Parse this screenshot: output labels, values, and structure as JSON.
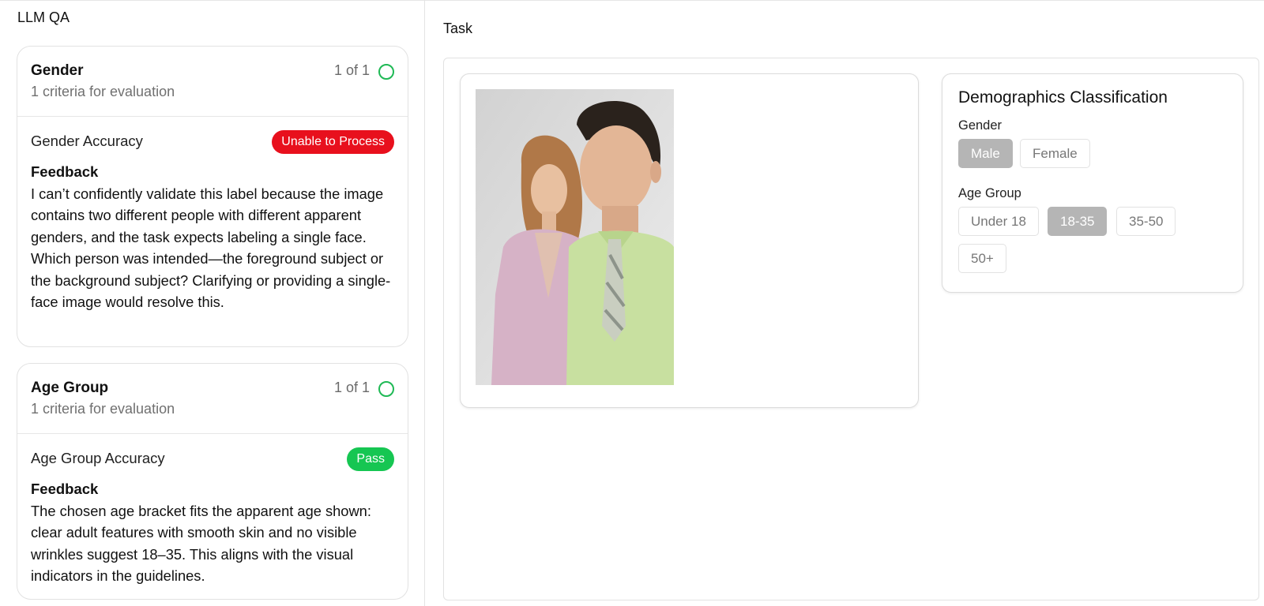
{
  "left_panel": {
    "title": "LLM QA",
    "sections": [
      {
        "title": "Gender",
        "subtitle": "1 criteria for evaluation",
        "count": "1 of 1",
        "criterion": "Gender Accuracy",
        "status": "Unable to Process",
        "status_color": "#e8101d",
        "feedback_title": "Feedback",
        "feedback": "I can’t confidently validate this label because the image contains two different people with different apparent genders, and the task expects labeling a single face. Which person was intended—the foreground subject or the background subject? Clarifying or providing a single-face image would resolve this."
      },
      {
        "title": "Age Group",
        "subtitle": "1 criteria for evaluation",
        "count": "1 of 1",
        "criterion": "Age Group Accuracy",
        "status": "Pass",
        "status_color": "#16c652",
        "feedback_title": "Feedback",
        "feedback": "The chosen age bracket fits the apparent age shown: clear adult features with smooth skin and no visible wrinkles suggest 18–35. This aligns with the visual indicators in the guidelines."
      }
    ]
  },
  "task": {
    "label": "Task",
    "image_icon": "photo-two-people",
    "classification": {
      "title": "Demographics Classification",
      "gender": {
        "label": "Gender",
        "options": [
          "Male",
          "Female"
        ],
        "selected": "Male"
      },
      "age_group": {
        "label": "Age Group",
        "options": [
          "Under 18",
          "18-35",
          "35-50",
          "50+"
        ],
        "selected": "18-35"
      }
    }
  }
}
